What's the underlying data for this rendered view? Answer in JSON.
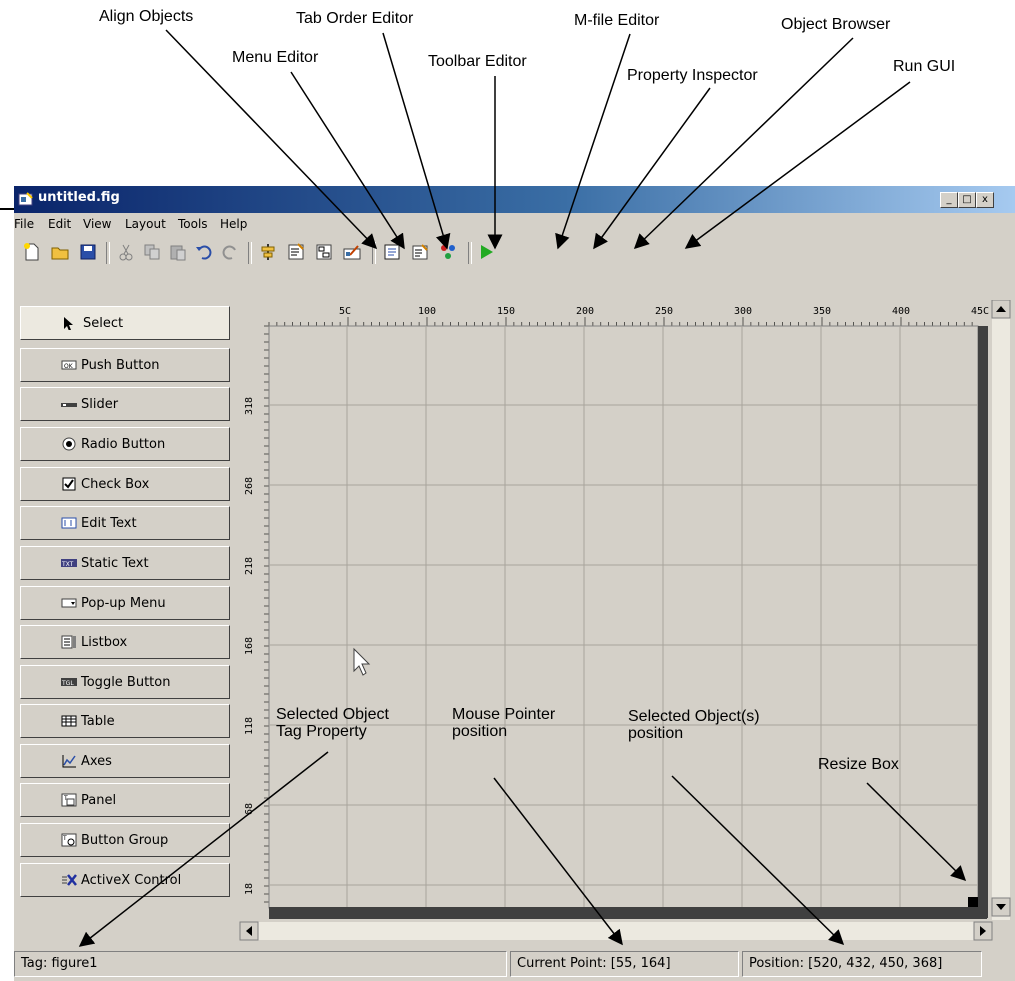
{
  "callouts": {
    "align_objects": "Align Objects",
    "tab_order_editor": "Tab Order Editor",
    "m_file_editor": "M-file Editor",
    "object_browser": "Object Browser",
    "menu_editor": "Menu Editor",
    "toolbar_editor": "Toolbar Editor",
    "property_inspector": "Property Inspector",
    "run_gui": "Run GUI",
    "selected_object_tag_1": "Selected Object",
    "selected_object_tag_2": "Tag Property",
    "mouse_pointer_1": "Mouse Pointer",
    "mouse_pointer_2": "position",
    "selected_objects_pos_1": "Selected Object(s)",
    "selected_objects_pos_2": "position",
    "resize_box": "Resize Box"
  },
  "window": {
    "title": "untitled.fig",
    "controls": {
      "minimize": "_",
      "maximize": "□",
      "close": "x"
    }
  },
  "menu": [
    "File",
    "Edit",
    "View",
    "Layout",
    "Tools",
    "Help"
  ],
  "toolbar": [
    "new-file",
    "open-folder",
    "save",
    "cut",
    "copy",
    "paste",
    "undo",
    "redo",
    "align-objects",
    "menu-editor",
    "tab-order-editor",
    "toolbar-editor",
    "m-file-editor",
    "property-inspector",
    "object-browser",
    "run-gui"
  ],
  "palette": [
    {
      "label": "Select",
      "icon": "arrow-pointer"
    },
    {
      "label": "Push Button",
      "icon": "ok-button"
    },
    {
      "label": "Slider",
      "icon": "slider"
    },
    {
      "label": "Radio Button",
      "icon": "radio"
    },
    {
      "label": "Check Box",
      "icon": "checkbox"
    },
    {
      "label": "Edit Text",
      "icon": "edit-text"
    },
    {
      "label": "Static Text",
      "icon": "static-text"
    },
    {
      "label": "Pop-up Menu",
      "icon": "popup"
    },
    {
      "label": "Listbox",
      "icon": "listbox"
    },
    {
      "label": "Toggle Button",
      "icon": "toggle"
    },
    {
      "label": "Table",
      "icon": "table"
    },
    {
      "label": "Axes",
      "icon": "axes"
    },
    {
      "label": "Panel",
      "icon": "panel"
    },
    {
      "label": "Button Group",
      "icon": "button-group"
    },
    {
      "label": "ActiveX Control",
      "icon": "activex"
    }
  ],
  "ruler": {
    "top": [
      "5C",
      "100",
      "150",
      "200",
      "250",
      "300",
      "350",
      "400",
      "45C"
    ],
    "left": [
      "318",
      "268",
      "218",
      "168",
      "118",
      "68",
      "18"
    ]
  },
  "status": {
    "tag": "Tag: figure1",
    "current_point": "Current Point:  [55, 164]",
    "position": "Position: [520, 432, 450, 368]"
  },
  "colors": {
    "titlebar_start": "#0a246a",
    "titlebar_end": "#a6caf0",
    "face": "#d4d0c8",
    "run_green": "#22aa22"
  }
}
